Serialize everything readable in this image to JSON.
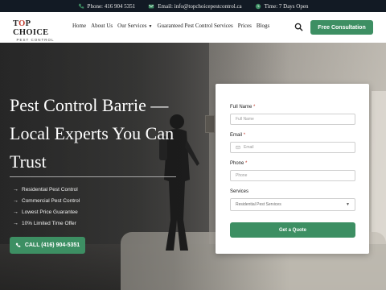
{
  "topbar": {
    "phone": "Phone: 416 904 5351",
    "email": "Email: info@topchoicepestcontrol.ca",
    "time": "Time: 7 Days Open"
  },
  "logo": {
    "main_1": "T",
    "main_o": "O",
    "main_2": "P CHOICE",
    "sub": "PEST CONTROL"
  },
  "nav": {
    "items": [
      "Home",
      "About Us",
      "Our Services",
      "Guaranteed Pest Control Services",
      "Prices",
      "Blogs"
    ],
    "cta": "Free Consultation"
  },
  "hero": {
    "headline": "Pest Control Barrie — Local Experts You Can Trust",
    "bullets": [
      "Residential Pest Control",
      "Commercial Pest Control",
      "Lowest Price Guarantee",
      "10% Limited Time Offer"
    ],
    "call_button": "CALL (416) 904-5351"
  },
  "form": {
    "full_name_label": "Full Name",
    "full_name_placeholder": "Full Name",
    "email_label": "Email",
    "email_placeholder": "Email",
    "phone_label": "Phone",
    "phone_placeholder": "Phone",
    "services_label": "Services",
    "services_selected": "Residential Pest Services",
    "submit": "Get a Quote",
    "required_mark": "*"
  },
  "colors": {
    "accent": "#3d8f63",
    "topbar_bg": "#121a24",
    "required": "#c0392b"
  }
}
